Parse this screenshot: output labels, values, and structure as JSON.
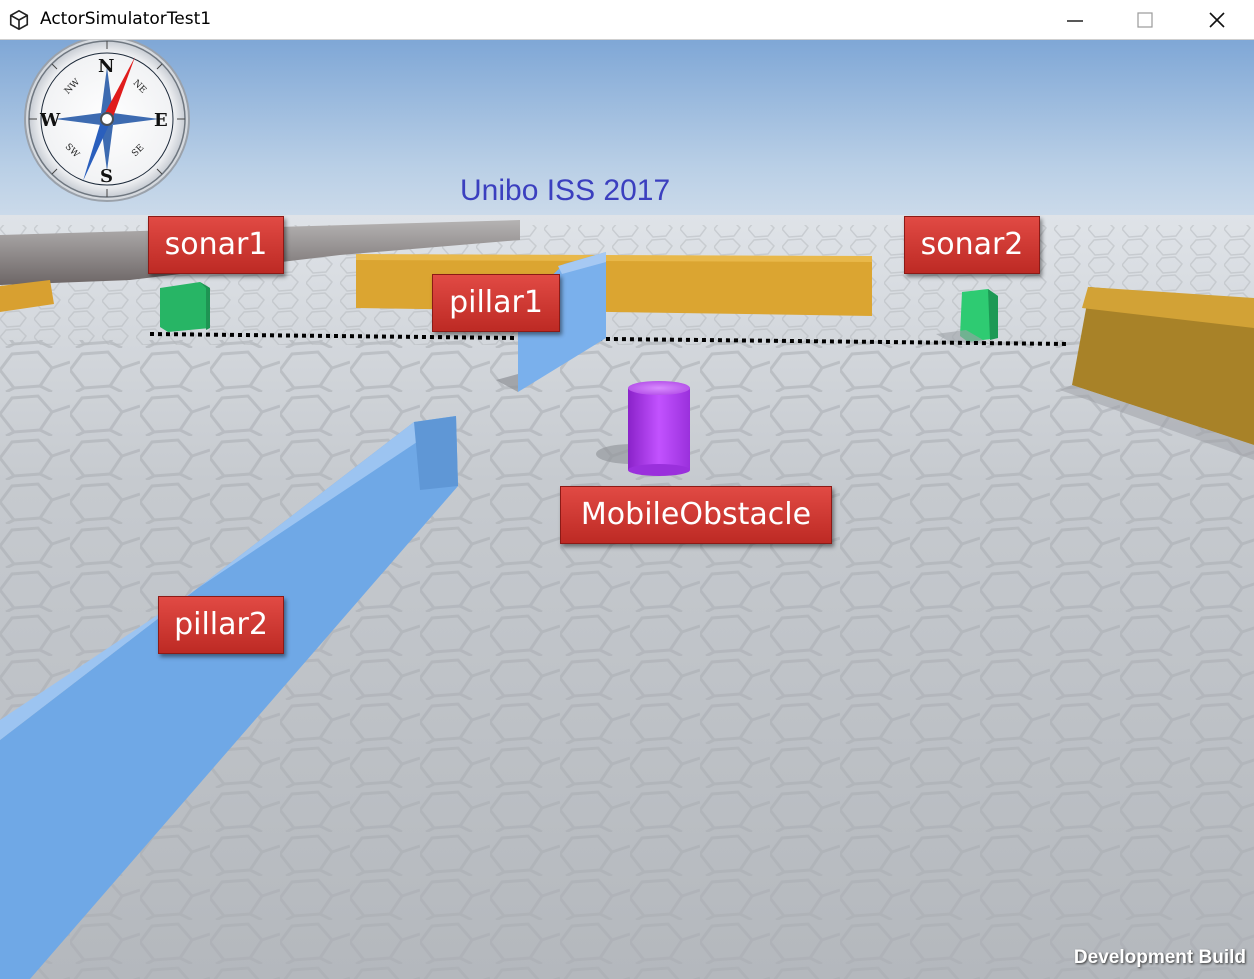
{
  "window": {
    "title": "ActorSimulatorTest1",
    "minimize_glyph": "—",
    "maximize_glyph": "☐",
    "close_glyph": "✕"
  },
  "scene": {
    "arena_title": "Unibo ISS 2017",
    "watermark": "Development Build",
    "compass": {
      "north": "N",
      "south": "S",
      "east": "E",
      "west": "W",
      "northeast": "NE",
      "northwest": "NW",
      "southeast": "SE",
      "southwest": "SW"
    },
    "labels": {
      "sonar1": "sonar1",
      "sonar2": "sonar2",
      "pillar1": "pillar1",
      "pillar2": "pillar2",
      "mobile_obstacle": "MobileObstacle"
    }
  },
  "colors": {
    "sky_top": "#7fa7d6",
    "floor": "#c4c8cc",
    "wall": "#d6a233",
    "pillar": "#6fa8e6",
    "sonar": "#2fbf6a",
    "obstacle": "#b83cf0",
    "label_bg": "#cf332d",
    "title_text": "#3b3fbf"
  }
}
